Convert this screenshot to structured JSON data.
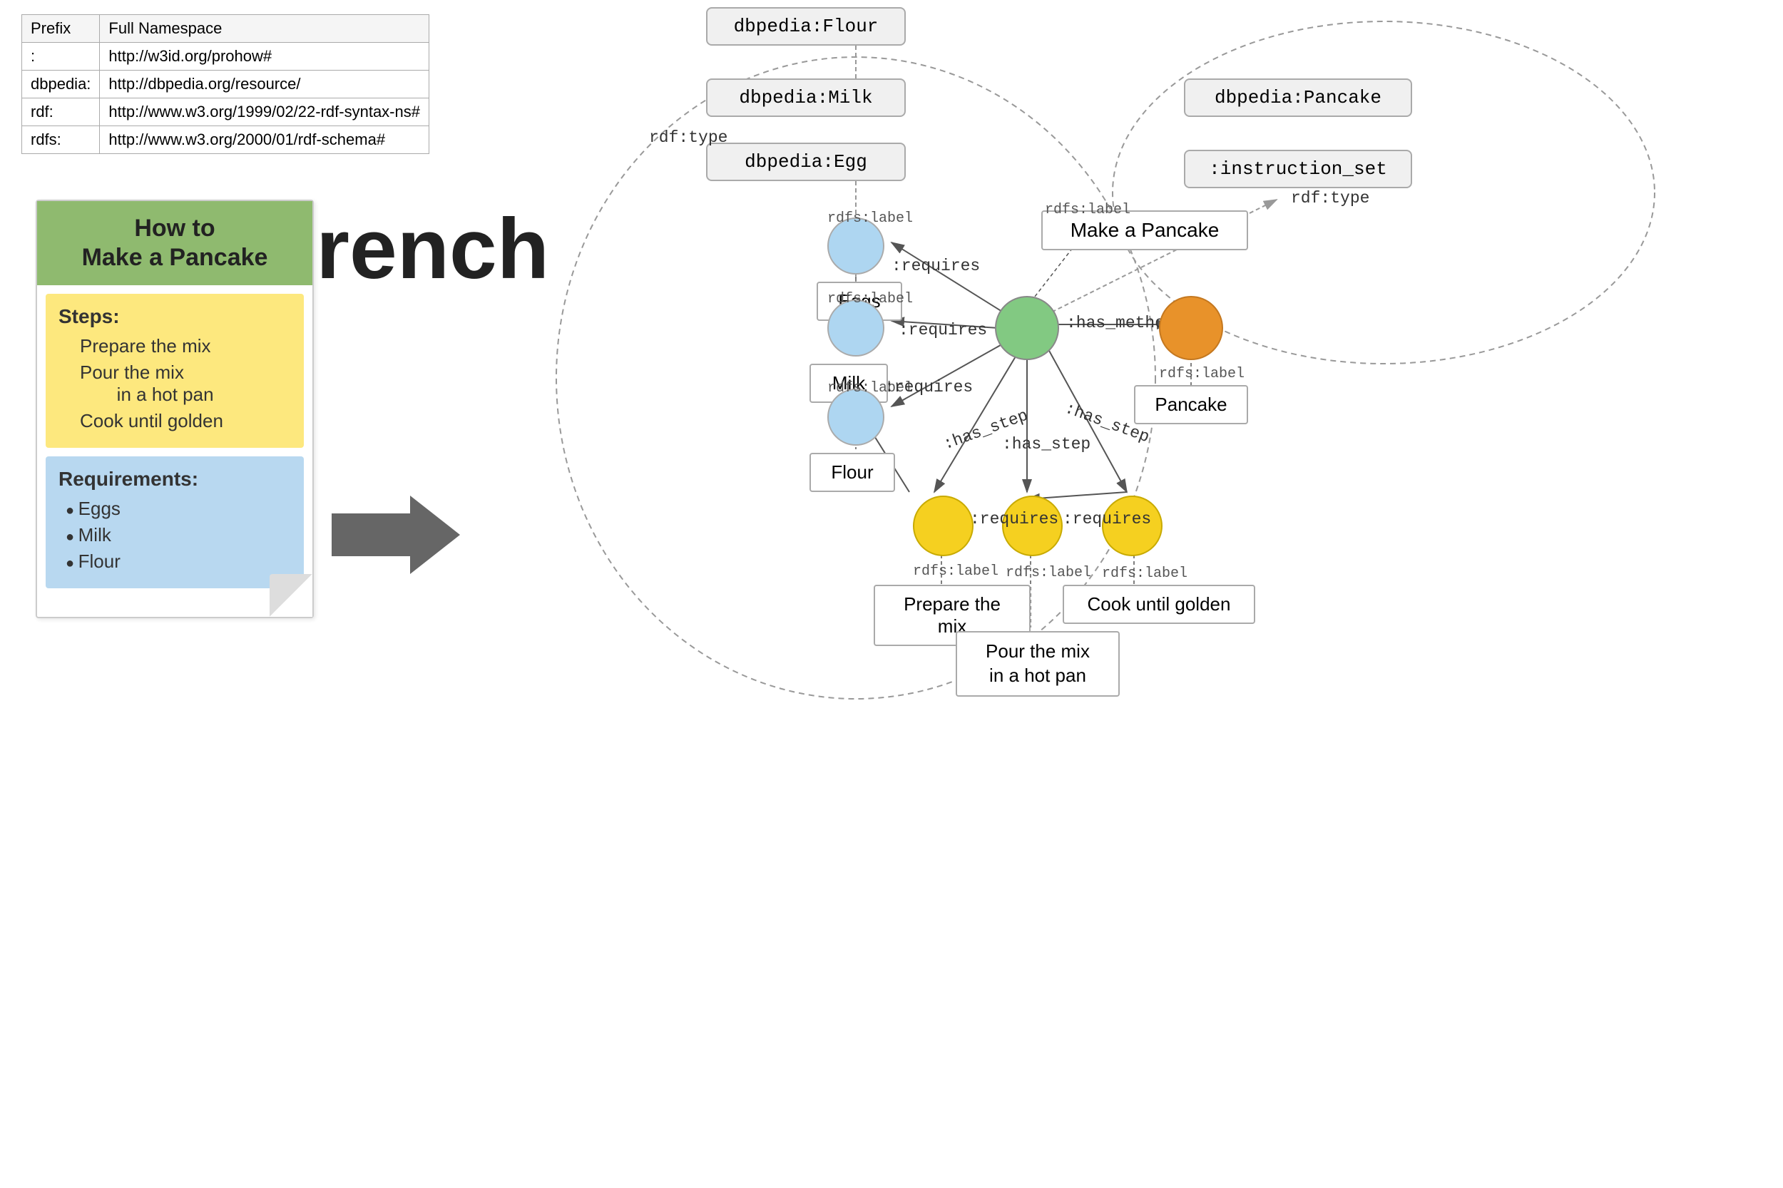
{
  "namespace_table": {
    "headers": [
      "Prefix",
      "Full Namespace"
    ],
    "rows": [
      [
        ":",
        "http://w3id.org/prohow#"
      ],
      [
        "dbpedia:",
        "http://dbpedia.org/resource/"
      ],
      [
        "rdf:",
        "http://www.w3.org/1999/02/22-rdf-syntax-ns#"
      ],
      [
        "rdfs:",
        "http://www.w3.org/2000/01/rdf-schema#"
      ]
    ]
  },
  "french_heading": "French",
  "recipe_card": {
    "title": "How to\nMake a Pancake",
    "steps_title": "Steps:",
    "steps": [
      "1.  Prepare the mix",
      "2.  Pour the mix\n     in a hot pan",
      "3.  Cook until golden"
    ],
    "requirements_title": "Requirements:",
    "requirements": [
      "Eggs",
      "Milk",
      "Flour"
    ]
  },
  "graph": {
    "nodes": {
      "flour_type": "dbpedia:Flour",
      "milk_type": "dbpedia:Milk",
      "egg_type": "dbpedia:Egg",
      "pancake_type": "dbpedia:Pancake",
      "instruction_set": ":instruction_set",
      "make_pancake": "Make a Pancake",
      "eggs_label": "Eggs",
      "milk_label": "Milk",
      "flour_label": "Flour",
      "pancake_label": "Pancake",
      "prepare_label": "Prepare the mix",
      "pour_label": "Pour the mix\nin a hot pan",
      "cook_label": "Cook until golden"
    },
    "edge_labels": {
      "rdf_type_left": "rdf:type",
      "rdf_type_right": "rdf:type",
      "rdfs_label_eggs": "rdfs:label",
      "rdfs_label_milk": "rdfs:label",
      "rdfs_label_flour": "rdfs:label",
      "rdfs_label_pancake": "rdfs:label",
      "rdfs_label_make": "rdfs:label",
      "rdfs_label_prepare": "rdfs:label",
      "rdfs_label_pour": "rdfs:label",
      "rdfs_label_cook": "rdfs:label",
      "requires_eggs": ":requires",
      "requires_milk": ":requires",
      "requires_flour": ":requires",
      "has_method": ":has_method",
      "has_step_1": ":has_step",
      "has_step_2": ":has_step",
      "has_step_3": ":has_step",
      "requires_prepare": ":requires",
      "requires_cook": ":requires"
    }
  }
}
